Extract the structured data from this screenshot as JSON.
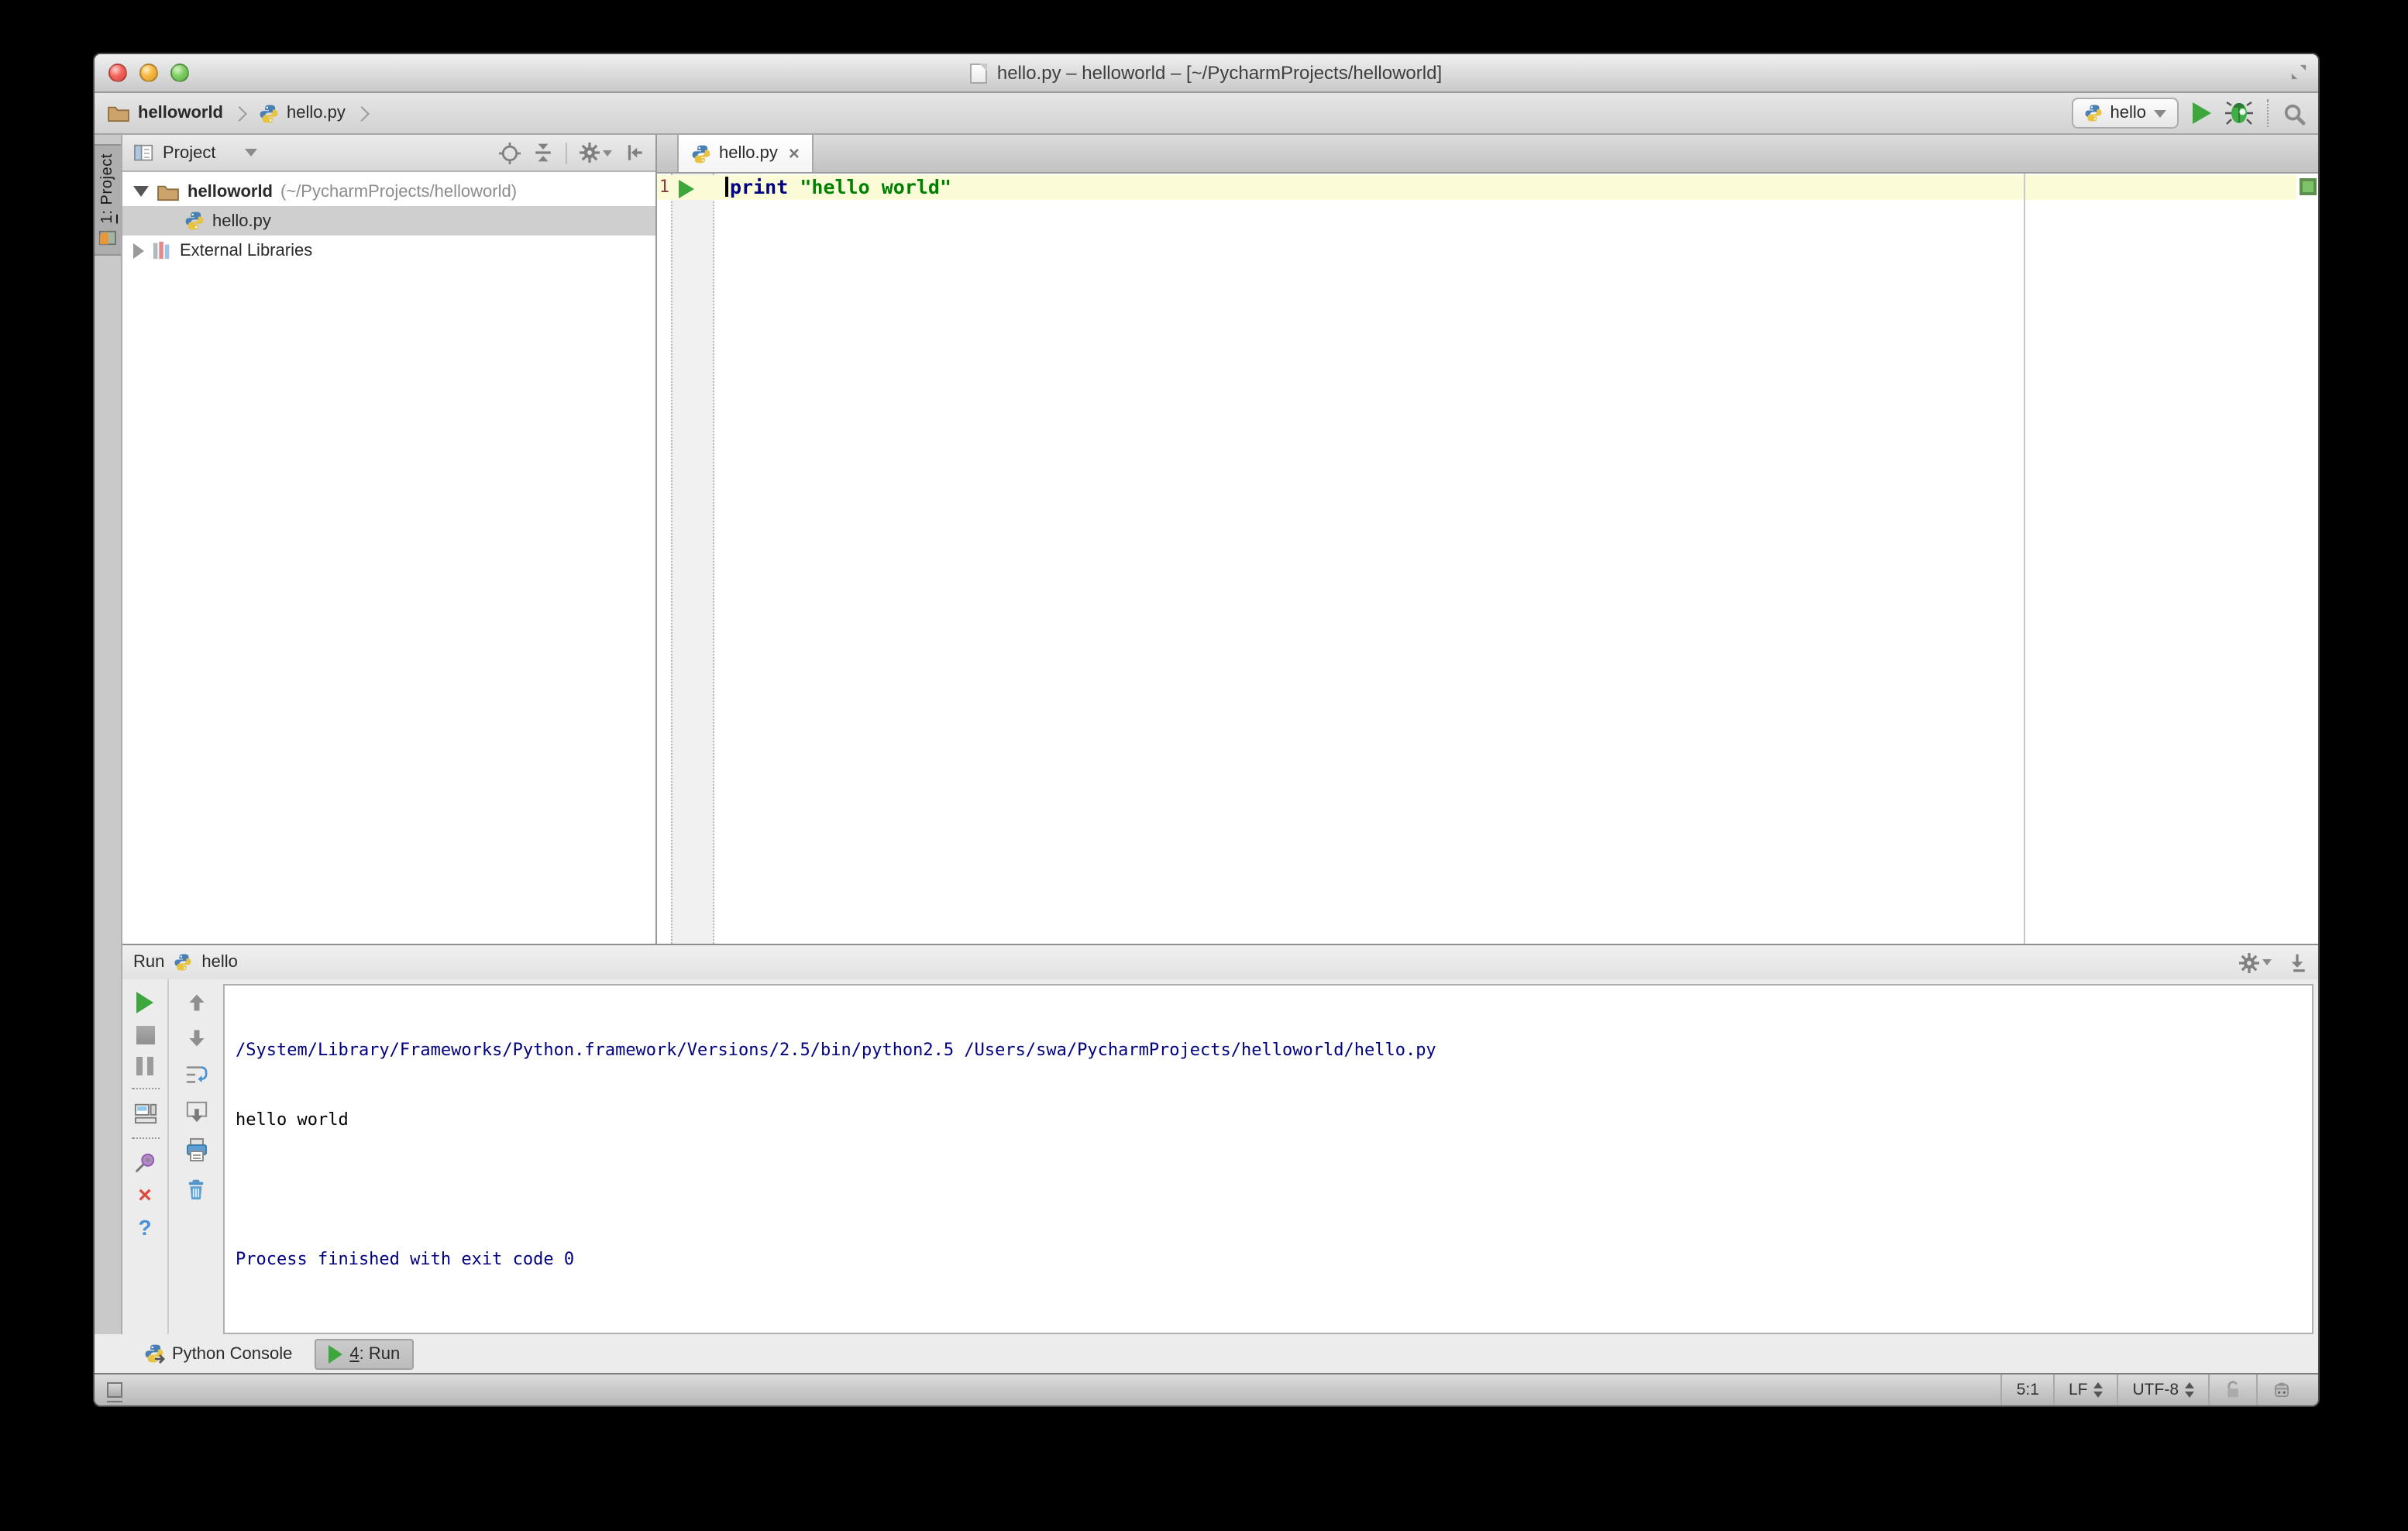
{
  "window": {
    "title": "hello.py – helloworld – [~/PycharmProjects/helloworld]"
  },
  "navbar": {
    "breadcrumbs": [
      {
        "label": "helloworld"
      },
      {
        "label": "hello.py"
      }
    ],
    "run_config": {
      "label": "hello"
    }
  },
  "stripe": {
    "project_button": {
      "mnemonic": "1",
      "rest": ": Project"
    }
  },
  "project_panel": {
    "header_label": "Project",
    "tree": [
      {
        "label": "helloworld",
        "path": "(~/PycharmProjects/helloworld)"
      },
      {
        "label": "hello.py"
      },
      {
        "label": "External Libraries"
      }
    ]
  },
  "editor": {
    "tab_label": "hello.py",
    "line_number": "1",
    "code": {
      "keyword": "print",
      "string": "\"hello world\""
    }
  },
  "run_panel": {
    "title": "Run",
    "config_name": "hello",
    "console_lines": [
      "/System/Library/Frameworks/Python.framework/Versions/2.5/bin/python2.5 /Users/swa/PycharmProjects/helloworld/hello.py",
      "hello world",
      "",
      "Process finished with exit code 0"
    ]
  },
  "bottom_bar": {
    "items": [
      {
        "label": "Python Console"
      },
      {
        "mnemonic": "4",
        "rest": ": Run"
      }
    ]
  },
  "status_bar": {
    "caret_position": "5:1",
    "line_separator": "LF",
    "encoding": "UTF-8"
  },
  "icons": {
    "close_glyph": "×",
    "help_glyph": "?"
  },
  "colors": {
    "run_green": "#3da73d",
    "keyword_blue": "#000080",
    "string_green": "#008000",
    "console_info_blue": "#000080",
    "current_line": "#fcfbd7",
    "inspection_ok_green": "#7dc368",
    "selection_gray": "#cfcfcf"
  }
}
